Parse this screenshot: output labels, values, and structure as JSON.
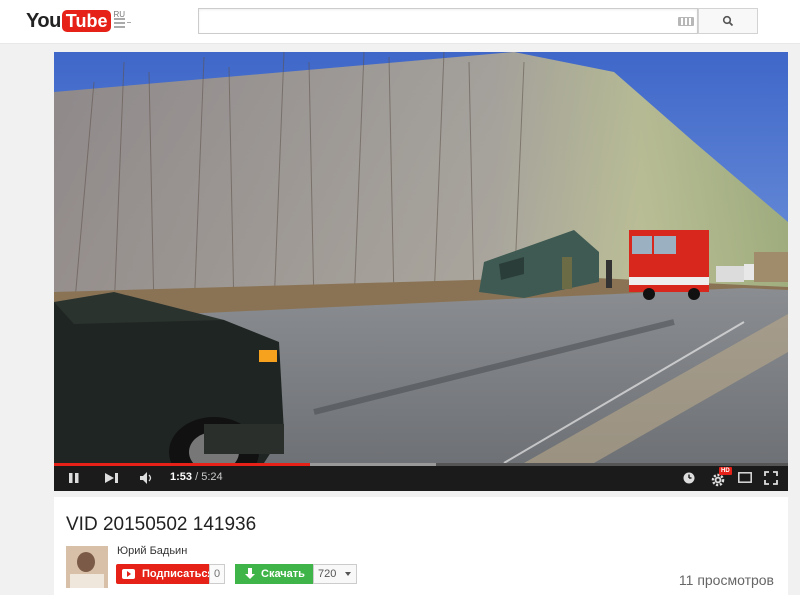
{
  "masthead": {
    "logo_you": "You",
    "logo_tube": "Tube",
    "logo_region": "RU",
    "search_value": ""
  },
  "player": {
    "current_time": "1:53",
    "separator": " / ",
    "duration": "5:24",
    "played_fraction": 0.349,
    "loaded_fraction": 0.52,
    "hd_badge": "HD"
  },
  "video": {
    "title": "VID 20150502 141936",
    "channel": "Юрий Бадьин",
    "subscribe_label": "Подписаться",
    "subscriber_count": "0",
    "download_label": "Скачать",
    "quality": "720",
    "views": "11 просмотров"
  },
  "colors": {
    "brand_red": "#e62117",
    "download_green": "#3fb449"
  }
}
